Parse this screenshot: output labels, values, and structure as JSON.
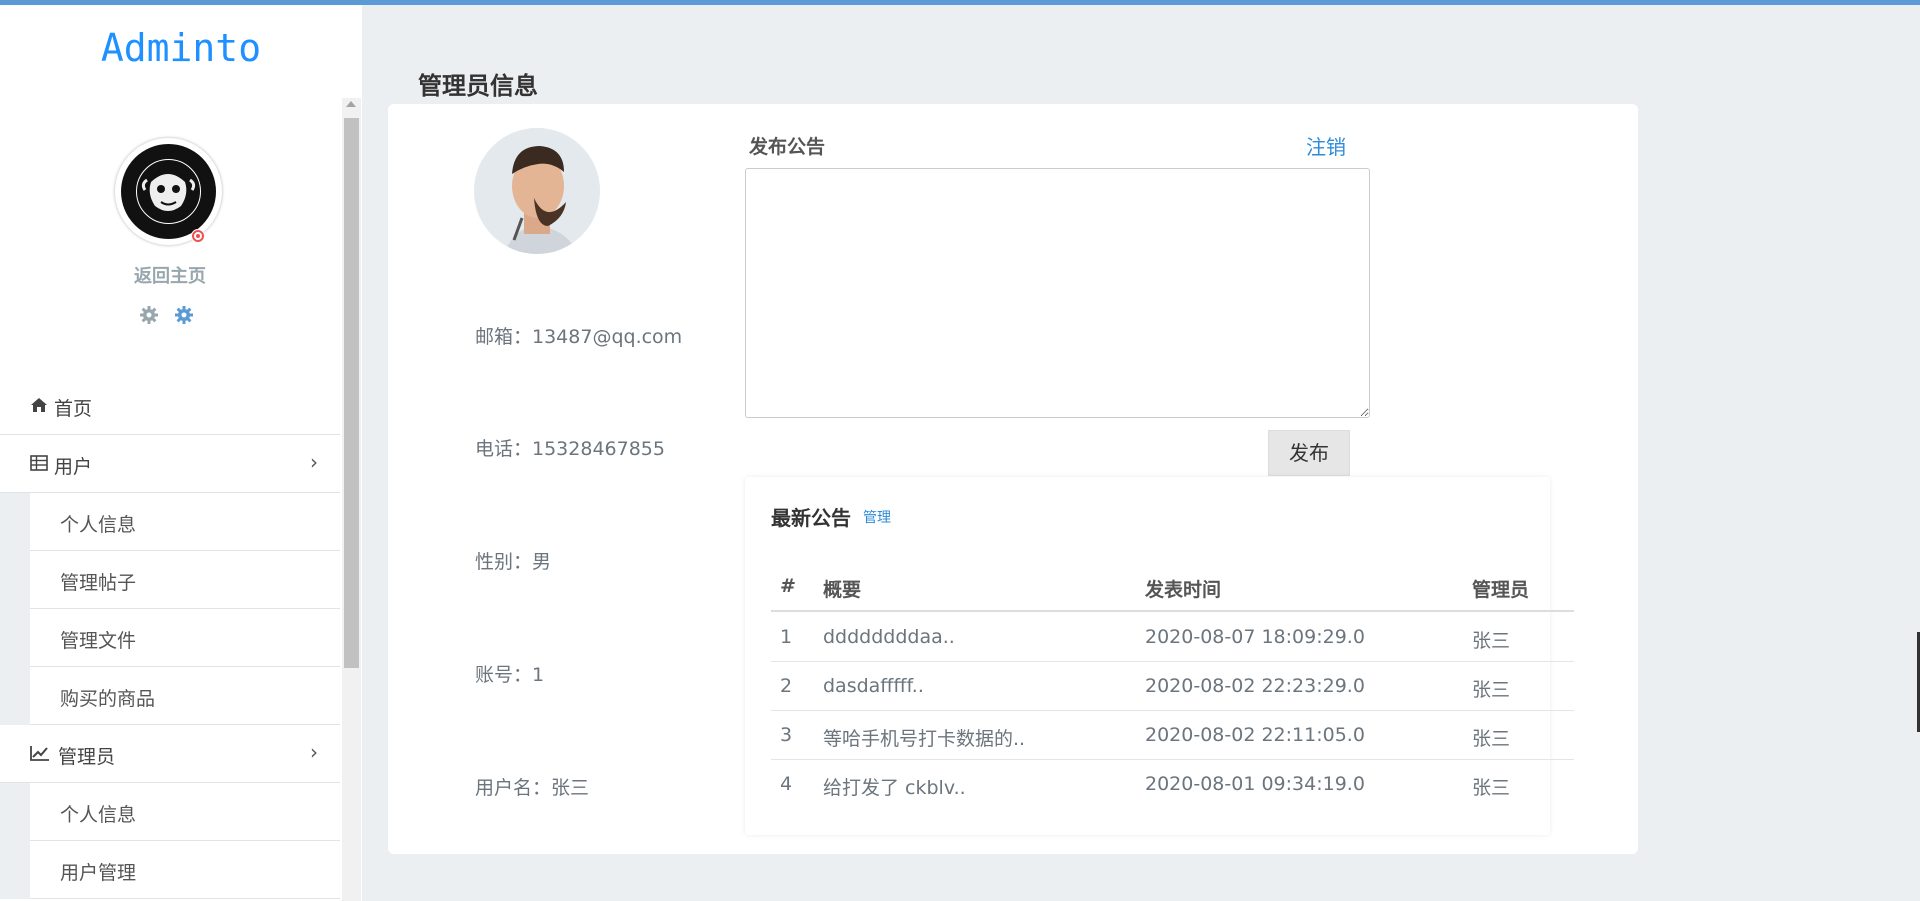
{
  "sidebar": {
    "logo": "Adminto",
    "home_link": "返回主页",
    "nav": {
      "home": "首页",
      "users": "用户",
      "user_sub": [
        "个人信息",
        "管理帖子",
        "管理文件",
        "购买的商品"
      ],
      "admin": "管理员",
      "admin_sub": [
        "个人信息",
        "用户管理"
      ]
    }
  },
  "main": {
    "page_title": "管理员信息",
    "profile": {
      "email": "邮箱：13487@qq.com",
      "phone": "电话：15328467855",
      "gender": "性别：男",
      "account": "账号：1",
      "username": "用户名：张三"
    },
    "announcement": {
      "title": "发布公告",
      "logout": "注销",
      "text_value": "",
      "publish_button": "发布"
    },
    "latest": {
      "title": "最新公告",
      "manage": "管理",
      "columns": [
        "#",
        "概要",
        "发表时间",
        "管理员"
      ],
      "rows": [
        {
          "no": "1",
          "summary": "ddddddddaa..",
          "time": "2020-08-07 18:09:29.0",
          "admin": "张三"
        },
        {
          "no": "2",
          "summary": "dasdafffff..",
          "time": "2020-08-02 22:23:29.0",
          "admin": "张三"
        },
        {
          "no": "3",
          "summary": "等哈手机号打卡数据的..",
          "time": "2020-08-02 22:11:05.0",
          "admin": "张三"
        },
        {
          "no": "4",
          "summary": "给打发了 ckblv..",
          "time": "2020-08-01 09:34:19.0",
          "admin": "张三"
        }
      ]
    }
  },
  "colors": {
    "accent": "#1e90ff",
    "link": "#2e8bd8",
    "status": "#f05050",
    "background": "#ebeff2"
  },
  "icons": [
    "home-icon",
    "table-icon",
    "chart-line-icon",
    "gear-icon",
    "chevron-right-icon",
    "status-icon"
  ]
}
